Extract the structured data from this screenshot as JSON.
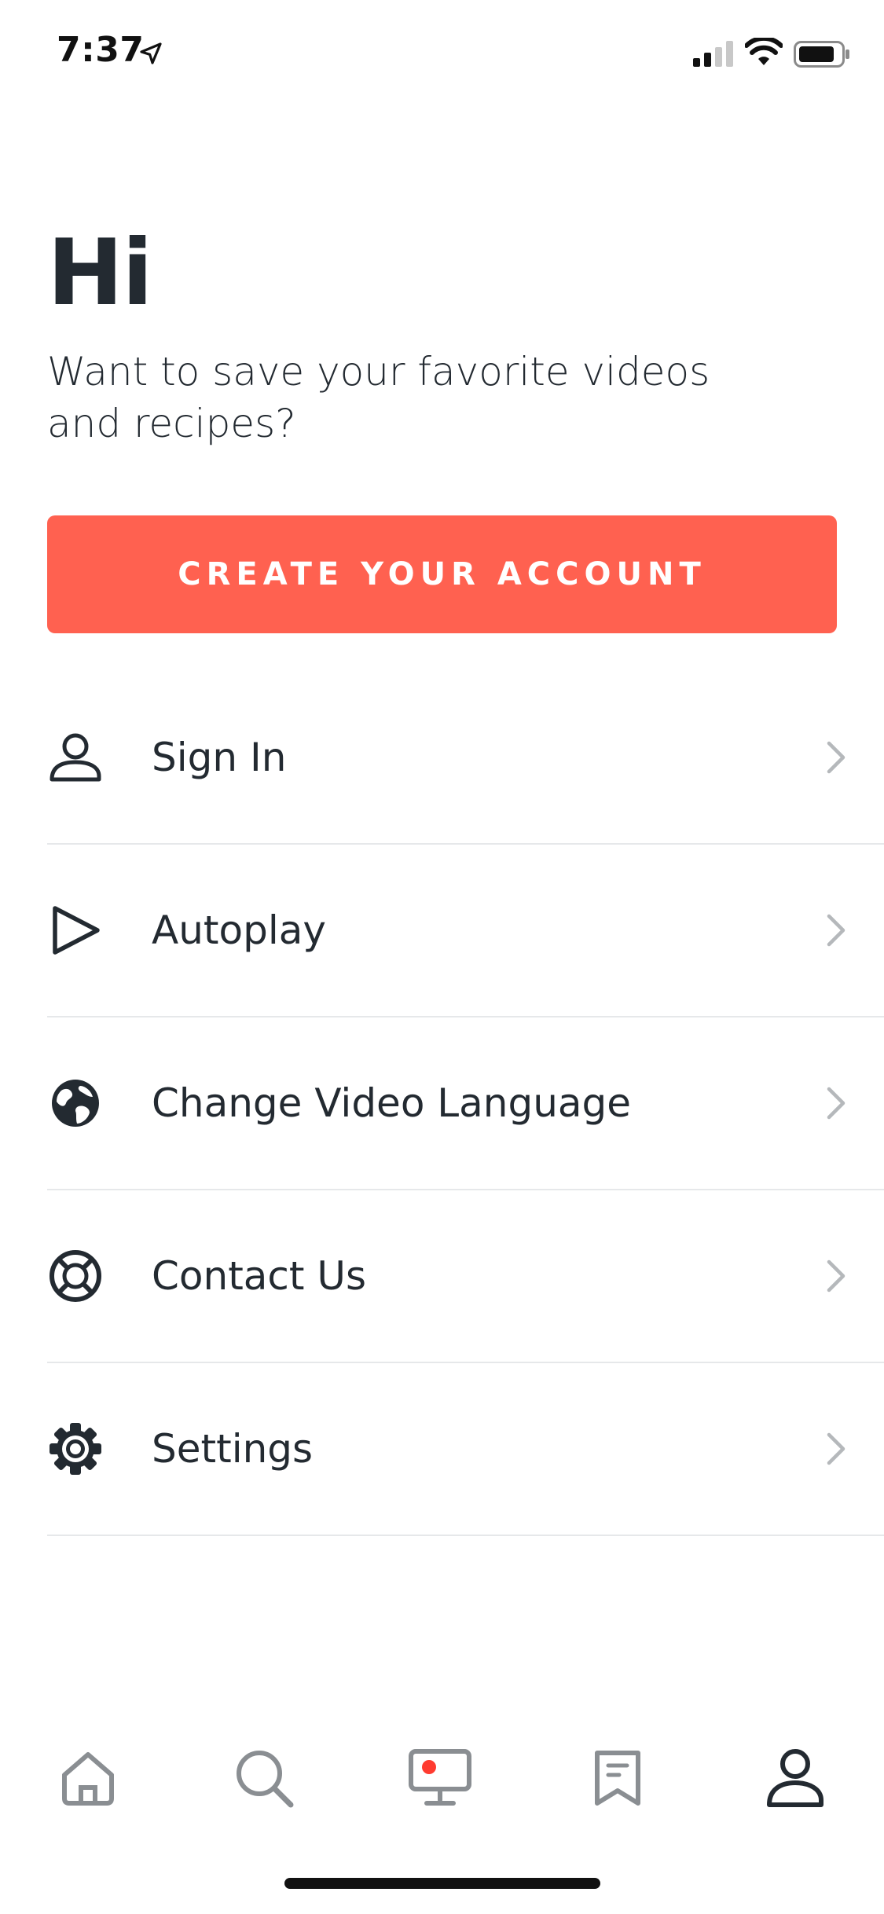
{
  "status_bar": {
    "time": "7:37",
    "icons": [
      "location-arrow-icon",
      "cellular-signal-icon",
      "wifi-icon",
      "battery-icon"
    ]
  },
  "header": {
    "greeting": "Hi",
    "subtitle": "Want to save your favorite videos and recipes?"
  },
  "cta": {
    "label": "CREATE YOUR ACCOUNT",
    "color": "#ff6150"
  },
  "menu": {
    "items": [
      {
        "label": "Sign In",
        "icon": "user-icon"
      },
      {
        "label": "Autoplay",
        "icon": "play-icon"
      },
      {
        "label": "Change Video Language",
        "icon": "globe-icon"
      },
      {
        "label": "Contact Us",
        "icon": "lifebuoy-icon"
      },
      {
        "label": "Settings",
        "icon": "gear-icon"
      }
    ]
  },
  "tabbar": {
    "tabs": [
      {
        "icon": "home-icon",
        "active": false
      },
      {
        "icon": "search-icon",
        "active": false
      },
      {
        "icon": "tv-icon",
        "active": false
      },
      {
        "icon": "bookmark-icon",
        "active": false
      },
      {
        "icon": "profile-icon",
        "active": true
      }
    ]
  },
  "colors": {
    "text": "#232a31",
    "accent": "#ff6150",
    "divider": "#e6e8ea",
    "tab_inactive": "#8a8e92",
    "tab_active": "#232a31",
    "chevron": "#b5b8bb"
  }
}
